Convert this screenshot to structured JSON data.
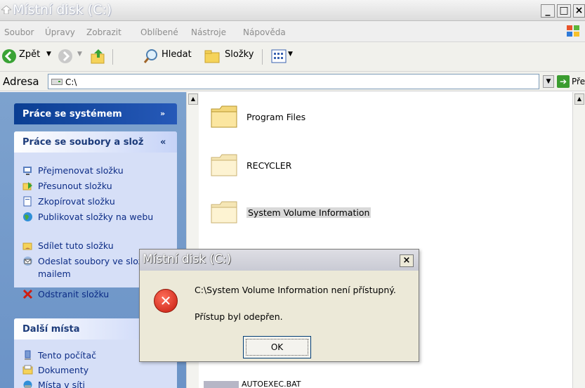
{
  "window": {
    "title": "Místní disk (C:)",
    "min": "_",
    "max": "□",
    "close": "×"
  },
  "menu": [
    {
      "label": "Soubor"
    },
    {
      "label": "Úpravy"
    },
    {
      "label": "Zobrazit"
    },
    {
      "label": "Oblíbené"
    },
    {
      "label": "Nástroje"
    },
    {
      "label": "Nápověda"
    }
  ],
  "toolbar": {
    "back": "Zpět",
    "search": "Hledat",
    "folders": "Složky"
  },
  "address": {
    "label": "Adresa",
    "value": "C:\\",
    "go": "Přejít"
  },
  "taskpane": {
    "system_header": "Práce se systémem",
    "files_header": "Práce se soubory a slož",
    "files_tasks": [
      {
        "label": "Přejmenovat složku",
        "icon": "rename-icon"
      },
      {
        "label": "Přesunout složku",
        "icon": "move-icon"
      },
      {
        "label": "Zkopírovat složku",
        "icon": "copy-icon"
      },
      {
        "label": "Publikovat složky na webu",
        "icon": "globe-icon"
      },
      {
        "label": "Sdílet tuto složku",
        "icon": "share-icon"
      },
      {
        "label": "Odeslat soubory ve složce e-mailem",
        "icon": "mail-icon"
      },
      {
        "label": "Odstranit složku",
        "icon": "delete-icon"
      }
    ],
    "places_header": "Další místa",
    "places": [
      {
        "label": "Tento počítač",
        "icon": "computer-icon"
      },
      {
        "label": "Dokumenty",
        "icon": "documents-icon"
      },
      {
        "label": "Místa v síti",
        "icon": "network-icon"
      }
    ]
  },
  "files": [
    {
      "name": "Program Files"
    },
    {
      "name": "RECYCLER"
    },
    {
      "name": "System Volume Information"
    }
  ],
  "bottom_file": "AUTOEXEC.BAT",
  "dialog": {
    "title": "Místní disk (C:)",
    "close": "×",
    "message": "C:\\System Volume Information není přístupný.",
    "detail": "Přístup byl odepřen.",
    "ok": "OK"
  },
  "colors": {
    "taskpane": "#7da2ce",
    "header_dark": "#0a3e93",
    "link": "#0c2c86",
    "error": "#c41a0d"
  }
}
